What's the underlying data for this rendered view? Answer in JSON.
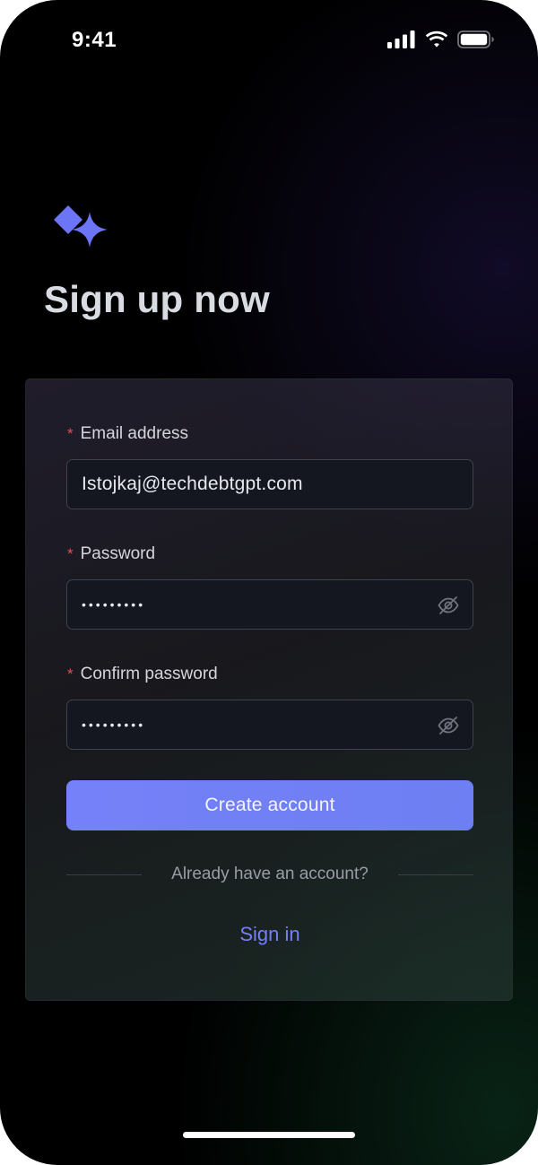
{
  "status_bar": {
    "time": "9:41",
    "icons": [
      "cellular-signal-icon",
      "wifi-icon",
      "battery-icon"
    ]
  },
  "brand": {
    "logo_icon": "diamond-sparkle-logo-icon",
    "accent_color": "#6c75f5"
  },
  "page": {
    "title": "Sign up now"
  },
  "form": {
    "required_marker": "*",
    "email": {
      "label": "Email address",
      "value": "Istojkaj@techdebtgpt.com"
    },
    "password": {
      "label": "Password",
      "value": "•••••••••",
      "toggle_icon": "eye-slash-icon"
    },
    "confirm_password": {
      "label": "Confirm password",
      "value": "•••••••••",
      "toggle_icon": "eye-slash-icon"
    },
    "submit_label": "Create account",
    "divider_text": "Already have an account?",
    "signin_label": "Sign in"
  },
  "colors": {
    "required": "#e05252",
    "link": "#7680f4",
    "button": "#7280f5"
  }
}
